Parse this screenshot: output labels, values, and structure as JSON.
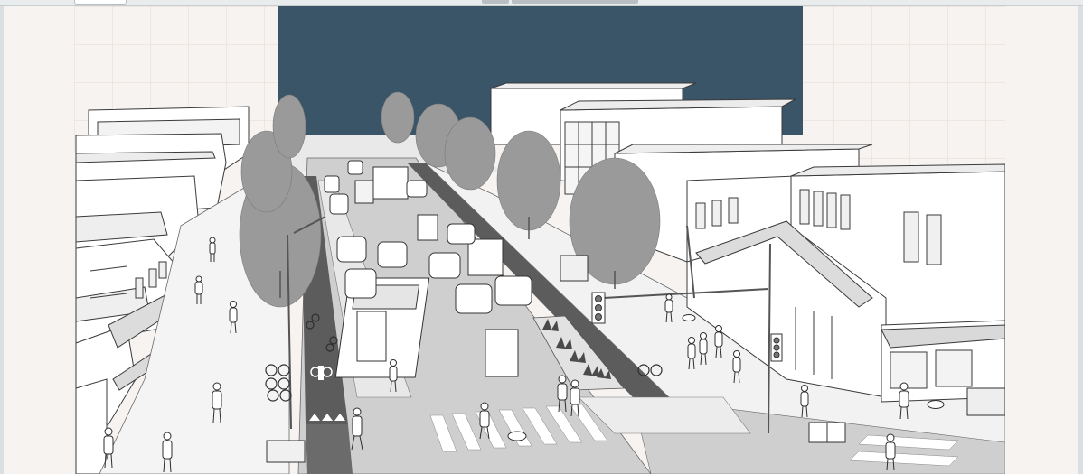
{
  "image": {
    "subject": "street-illustration",
    "colors": {
      "sky": "#3a5468",
      "background": "#f7f3f1",
      "grid": "#e6dcd7",
      "road": "#cfcfcf",
      "bike_lane": "#5c5c5c",
      "trees": "#9a9a9a",
      "building_fill": "#ffffff",
      "line": "#3a3a3a"
    }
  }
}
